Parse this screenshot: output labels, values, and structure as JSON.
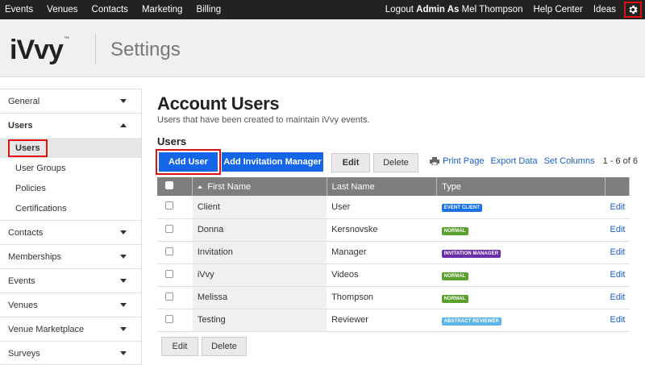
{
  "topnav": {
    "left": [
      "Events",
      "Venues",
      "Contacts",
      "Marketing",
      "Billing"
    ],
    "logout": "Logout",
    "admin_as": "Admin As",
    "user": "Mel Thompson",
    "help": "Help Center",
    "ideas": "Ideas",
    "settings_icon": "gear-icon"
  },
  "header": {
    "logo": "iVvy",
    "title": "Settings"
  },
  "sidebar": {
    "items": [
      {
        "label": "General"
      },
      {
        "label": "Users"
      },
      {
        "label": "Contacts"
      },
      {
        "label": "Memberships"
      },
      {
        "label": "Events"
      },
      {
        "label": "Venues"
      },
      {
        "label": "Venue Marketplace"
      },
      {
        "label": "Surveys"
      }
    ],
    "sub_items": [
      {
        "label": "Users"
      },
      {
        "label": "User Groups"
      },
      {
        "label": "Policies"
      },
      {
        "label": "Certifications"
      }
    ]
  },
  "main": {
    "title": "Account Users",
    "description": "Users that have been created to maintain iVvy events.",
    "section": "Users",
    "buttons": {
      "add_user": "Add User",
      "add_invitation_manager": "Add Invitation Manager",
      "edit": "Edit",
      "delete": "Delete"
    },
    "links": {
      "print": "Print Page",
      "export": "Export Data",
      "columns": "Set Columns",
      "count": "1 - 6 of 6"
    },
    "table": {
      "headers": [
        "First Name",
        "Last Name",
        "Type"
      ],
      "rows": [
        {
          "first": "Client",
          "last": "User",
          "type": "EVENT CLIENT",
          "edit": "Edit"
        },
        {
          "first": "Donna",
          "last": "Kersnovske",
          "type": "NORMAL",
          "edit": "Edit"
        },
        {
          "first": "Invitation",
          "last": "Manager",
          "type": "INVITATION MANAGER",
          "edit": "Edit"
        },
        {
          "first": "iVvy",
          "last": "Videos",
          "type": "NORMAL",
          "edit": "Edit"
        },
        {
          "first": "Melissa",
          "last": "Thompson",
          "type": "NORMAL",
          "edit": "Edit"
        },
        {
          "first": "Testing",
          "last": "Reviewer",
          "type": "ABSTRACT REVIEWER",
          "edit": "Edit"
        }
      ]
    },
    "bottom_buttons": {
      "edit": "Edit",
      "delete": "Delete"
    }
  },
  "colors": {
    "accent": "#1565e8",
    "highlight": "#dd1111",
    "event_client": "#1a73e8",
    "normal": "#5aa02c",
    "invitation_manager": "#6a2fa8",
    "abstract_reviewer": "#5ab4e8"
  }
}
